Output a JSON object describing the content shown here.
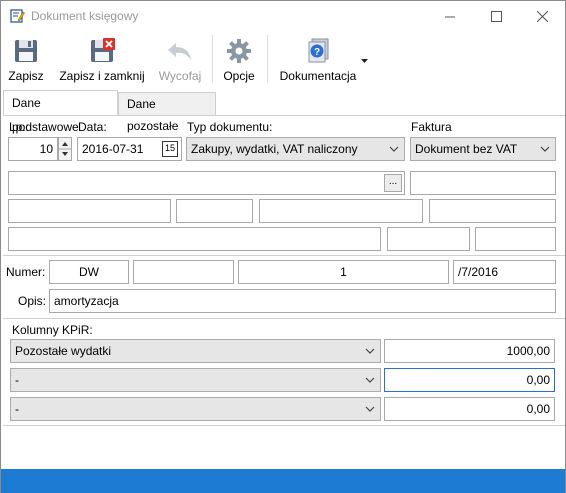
{
  "window": {
    "title": "Dokument księgowy",
    "minimize_icon": "minimize-icon",
    "maximize_icon": "maximize-icon",
    "close_icon": "close-icon"
  },
  "toolbar": {
    "save_label": "Zapisz",
    "save_close_label": "Zapisz i zamknij",
    "undo_label": "Wycofaj",
    "options_label": "Opcje",
    "docs_label": "Dokumentacja"
  },
  "tabs": [
    {
      "label": "Dane podstawowe",
      "active": true
    },
    {
      "label": "Dane pozostałe",
      "active": false
    }
  ],
  "form": {
    "lp_label": "Lp.:",
    "lp_value": "10",
    "date_label": "Data:",
    "date_value": "2016-07-31",
    "calendar_glyph": "15",
    "type_label": "Typ dokumentu:",
    "type_value": "Zakupy, wydatki, VAT naliczony",
    "invoice_label": "Faktura",
    "invoice_value": "Dokument bez VAT",
    "browse_label": "...",
    "number_label": "Numer:",
    "number_prefix": "DW",
    "number_mid": "",
    "number_seq": "1",
    "number_suffix": "/7/2016",
    "desc_label": "Opis:",
    "desc_value": "amortyzacja"
  },
  "kpir": {
    "label": "Kolumny KPiR:",
    "rows": [
      {
        "column": "Pozostałe wydatki",
        "amount": "1000,00"
      },
      {
        "column": "-",
        "amount": "0,00"
      },
      {
        "column": "-",
        "amount": "0,00"
      }
    ]
  },
  "colors": {
    "statusbar": "#1e7bd4",
    "active_field_border": "#2a6fd6"
  }
}
